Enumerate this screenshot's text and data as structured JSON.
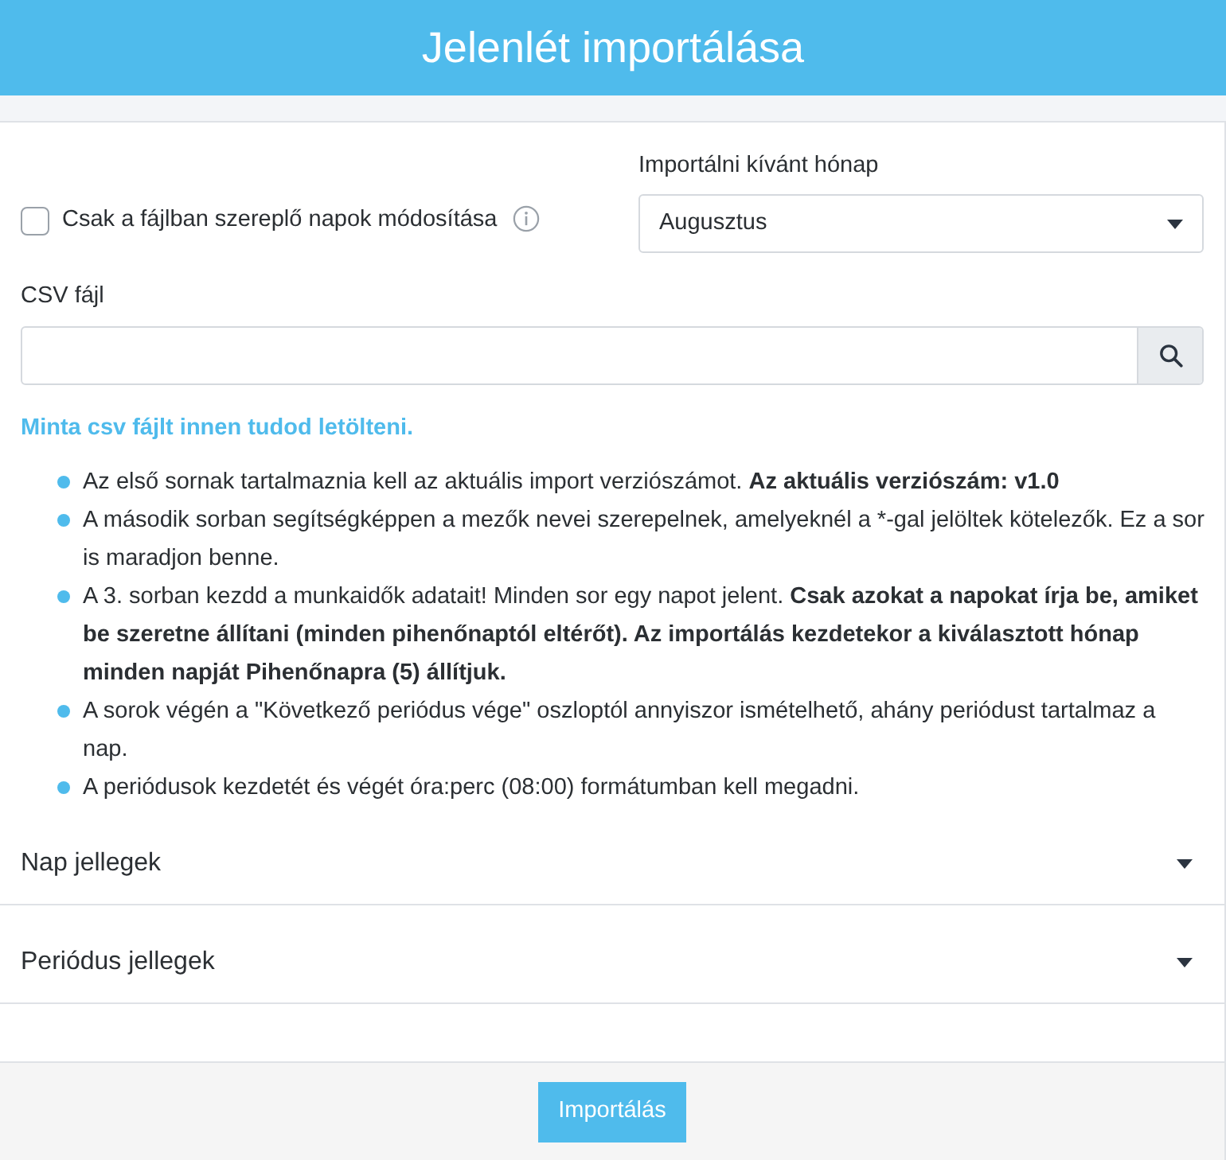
{
  "header": {
    "title": "Jelenlét importálása"
  },
  "options": {
    "only_file_days": {
      "label": "Csak a fájlban szereplő napok módosítása",
      "checked": false
    },
    "month": {
      "label": "Importálni kívánt hónap",
      "value": "Augusztus"
    }
  },
  "csv": {
    "label": "CSV fájl"
  },
  "sample_link": "Minta csv fájlt innen tudod letölteni.",
  "instructions": [
    "Az első sornak tartalmaznia kell az aktuális import verziószámot. **Az aktuális verziószám: v1.0**",
    "A második sorban segítségképpen a mezők nevei szerepelnek, amelyeknél a *-gal jelöltek kötelezők. Ez a sor is maradjon benne.",
    "A 3. sorban kezdd a munkaidők adatait! Minden sor egy napot jelent. **Csak azokat a napokat írja be, amiket be szeretne állítani (minden pihenőnaptól eltérőt). Az importálás kezdetekor a kiválasztott hónap minden napját Pihenőnapra (5) állítjuk.**",
    "A sorok végén a \"Következő periódus vége\" oszloptól annyiszor ismételhető, ahány periódust tartalmaz a nap.",
    "A periódusok kezdetét és végét óra:perc (08:00) formátumban kell megadni."
  ],
  "sections": [
    {
      "title": "Nap jellegek",
      "expanded": false
    },
    {
      "title": "Periódus jellegek",
      "expanded": false
    }
  ],
  "footer": {
    "button": "Importálás"
  }
}
